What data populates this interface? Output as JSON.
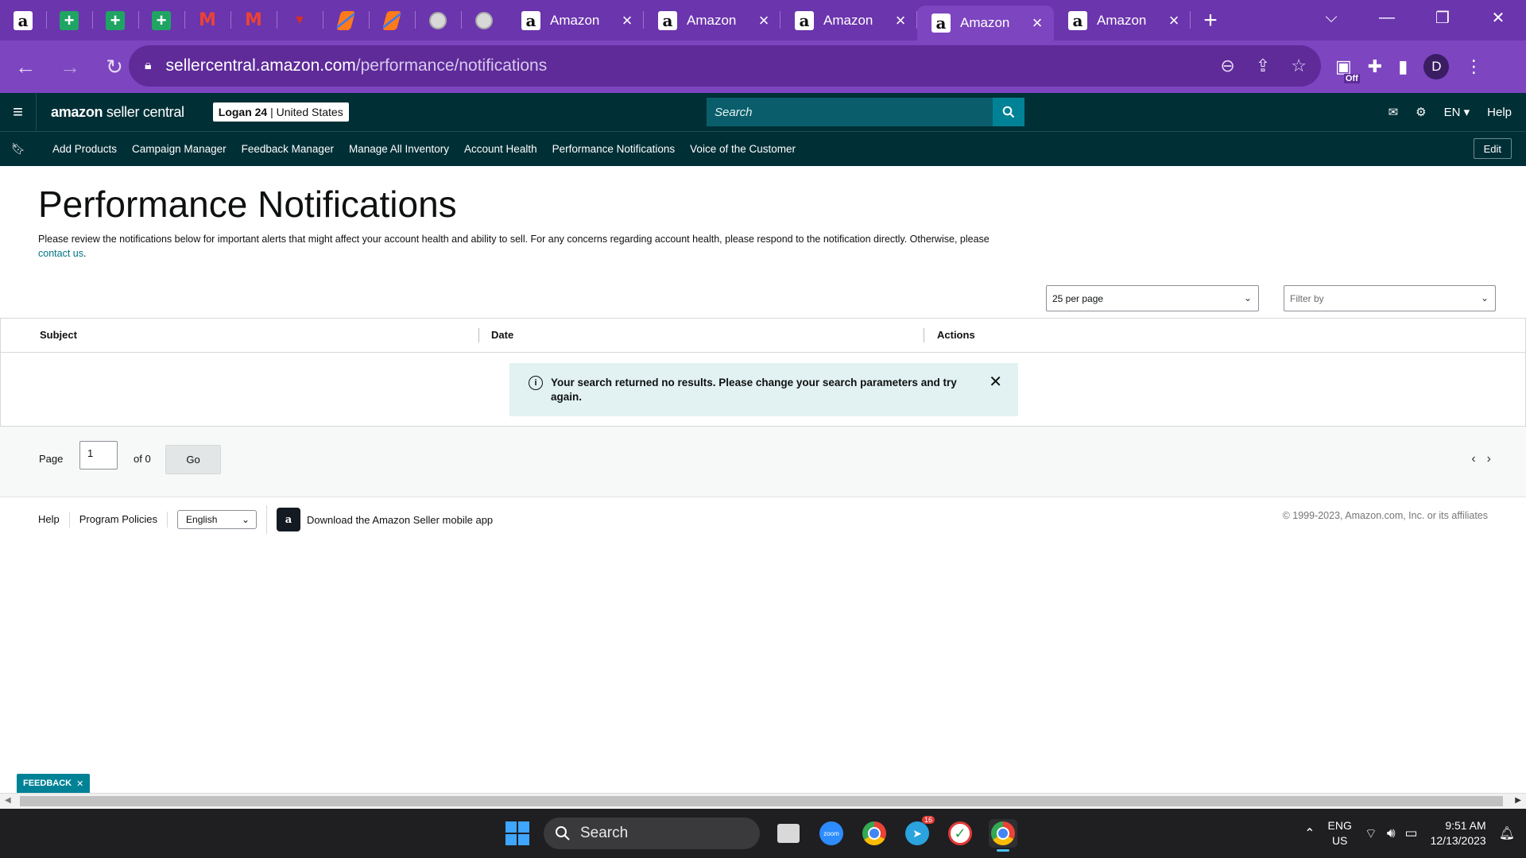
{
  "browser": {
    "pinned_tabs": [
      {
        "icon": "amazon-icon",
        "glyph": "a"
      },
      {
        "icon": "sheets-icon",
        "glyph": "+"
      },
      {
        "icon": "sheets-icon",
        "glyph": "+"
      },
      {
        "icon": "sheets-icon",
        "glyph": "+"
      },
      {
        "icon": "gmail-icon",
        "glyph": "M"
      },
      {
        "icon": "gmail-icon",
        "glyph": "M"
      },
      {
        "icon": "app-icon",
        "glyph": "▼"
      },
      {
        "icon": "tool-icon",
        "glyph": ""
      },
      {
        "icon": "tool-icon",
        "glyph": ""
      },
      {
        "icon": "globe-icon",
        "glyph": ""
      },
      {
        "icon": "globe-icon",
        "glyph": ""
      }
    ],
    "tabs": [
      {
        "title": "Amazon",
        "glyph": "a",
        "active": false
      },
      {
        "title": "Amazon",
        "glyph": "a",
        "active": false
      },
      {
        "title": "Amazon",
        "glyph": "a",
        "active": false
      },
      {
        "title": "Amazon",
        "glyph": "a",
        "active": true
      },
      {
        "title": "Amazon",
        "glyph": "a",
        "active": false
      }
    ],
    "url_host": "sellercentral.amazon.com",
    "url_path": "/performance/notifications",
    "extension_badge": "Off",
    "profile_initial": "D"
  },
  "header": {
    "logo_bold": "amazon",
    "logo_rest": " seller central",
    "account_name": "Logan 24",
    "account_region": " | United States",
    "search_placeholder": "Search",
    "language": "EN",
    "help": "Help"
  },
  "subnav": {
    "links": [
      "Add Products",
      "Campaign Manager",
      "Feedback Manager",
      "Manage All Inventory",
      "Account Health",
      "Performance Notifications",
      "Voice of the Customer"
    ],
    "edit": "Edit"
  },
  "page": {
    "title": "Performance Notifications",
    "description": "Please review the notifications below for important alerts that might affect your account health and ability to sell. For any concerns regarding account health, please respond to the notification directly. Otherwise, please",
    "contact_link": "contact us",
    "per_page": "25 per page",
    "filter_placeholder": "Filter by"
  },
  "table": {
    "columns": [
      "Subject",
      "Date",
      "Actions"
    ],
    "empty_message": "Your search returned no results. Please change your search parameters and try again."
  },
  "pager": {
    "label": "Page",
    "current": "1",
    "of_total": "of 0",
    "go": "Go"
  },
  "footer": {
    "links": [
      "Help",
      "Program Policies"
    ],
    "language": "English",
    "app_text": "Download the Amazon Seller mobile app",
    "copyright": "© 1999-2023, Amazon.com, Inc. or its affiliates"
  },
  "feedback": "FEEDBACK",
  "taskbar": {
    "search": "Search",
    "telegram_badge": "16",
    "lang_top": "ENG",
    "lang_bottom": "US",
    "time": "9:51 AM",
    "date": "12/13/2023"
  },
  "colors": {
    "browser_frame": "#6b35ad",
    "seller_header": "#002f36",
    "link": "#007185",
    "alert_bg": "#e2f1f2"
  }
}
